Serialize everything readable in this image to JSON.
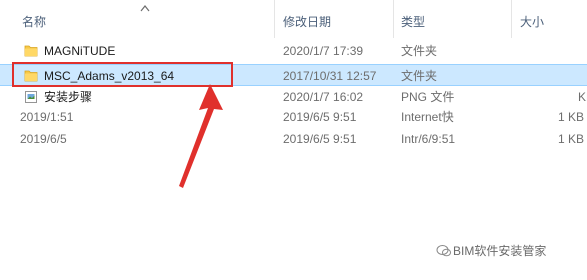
{
  "header": {
    "col_name": "名称",
    "col_date": "修改日期",
    "col_type": "类型",
    "col_size": "大小"
  },
  "rows": [
    {
      "name": "MAGNiTUDE",
      "date": "2020/1/7 17:39",
      "type": "文件夹",
      "size": "",
      "icon": "folder-icon"
    },
    {
      "name": "MSC_Adams_v2013_64",
      "date": "2017/10/31 12:57",
      "type": "文件夹",
      "size": "",
      "icon": "folder-icon",
      "selected": true
    },
    {
      "name": "安装步骤",
      "date": "2020/1/7 16:02",
      "type": "PNG 文件",
      "size": "KB",
      "icon": "image-file-icon"
    },
    {
      "name": "2019/1:51",
      "date": "2019/6/5 9:51",
      "type": "Internet快",
      "size": "1 KB",
      "icon": ""
    },
    {
      "name": "2019/6/5",
      "date": "2019/6/5 9:51",
      "type": "Intr/6/9:51",
      "size": "1 KB",
      "icon": ""
    }
  ],
  "watermark": "BIM软件安装管家",
  "colors": {
    "selection": "#cce8ff",
    "highlight_border": "#e0302c",
    "arrow": "#e0302c",
    "header_text": "#4c607a"
  }
}
